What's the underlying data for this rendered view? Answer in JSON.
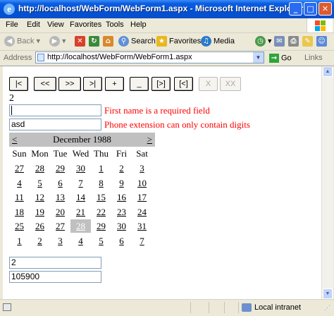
{
  "window": {
    "title": "http://localhost/WebForm/WebForm1.aspx - Microsoft Internet Explorer",
    "minimize": "_",
    "maximize": "□",
    "close": "✕"
  },
  "menu": [
    "File",
    "Edit",
    "View",
    "Favorites",
    "Tools",
    "Help"
  ],
  "toolbar": {
    "back": "Back",
    "search": "Search",
    "favorites": "Favorites",
    "media": "Media"
  },
  "address": {
    "label": "Address",
    "url": "http://localhost/WebForm/WebForm1.aspx",
    "go": "Go",
    "links": "Links"
  },
  "page": {
    "nav_buttons": [
      {
        "label": "|<",
        "enabled": true
      },
      {
        "label": "<<",
        "enabled": true
      },
      {
        "label": ">>",
        "enabled": true
      },
      {
        "label": ">|",
        "enabled": true
      },
      {
        "label": "+",
        "enabled": true
      },
      {
        "label": "_",
        "enabled": true
      },
      {
        "label": "[>]",
        "enabled": true
      },
      {
        "label": "[<]",
        "enabled": true
      },
      {
        "label": "X",
        "enabled": false
      },
      {
        "label": "XX",
        "enabled": false
      }
    ],
    "record_counter": "2",
    "first_name_value": "",
    "first_name_error": "First name is a required field",
    "phone_value": "asd",
    "phone_error": "Phone extension can only contain digits",
    "calendar": {
      "prev": "<",
      "next": ">",
      "title": "December 1988",
      "days_of_week": [
        "Sun",
        "Mon",
        "Tue",
        "Wed",
        "Thu",
        "Fri",
        "Sat"
      ],
      "weeks": [
        [
          "27",
          "28",
          "29",
          "30",
          "1",
          "2",
          "3"
        ],
        [
          "4",
          "5",
          "6",
          "7",
          "8",
          "9",
          "10"
        ],
        [
          "11",
          "12",
          "13",
          "14",
          "15",
          "16",
          "17"
        ],
        [
          "18",
          "19",
          "20",
          "21",
          "22",
          "23",
          "24"
        ],
        [
          "25",
          "26",
          "27",
          "28",
          "29",
          "30",
          "31"
        ],
        [
          "1",
          "2",
          "3",
          "4",
          "5",
          "6",
          "7"
        ]
      ],
      "selected_week": 4,
      "selected_day": 3
    },
    "field_a_value": "2",
    "field_b_value": "105900"
  },
  "status": {
    "zone": "Local intranet"
  }
}
